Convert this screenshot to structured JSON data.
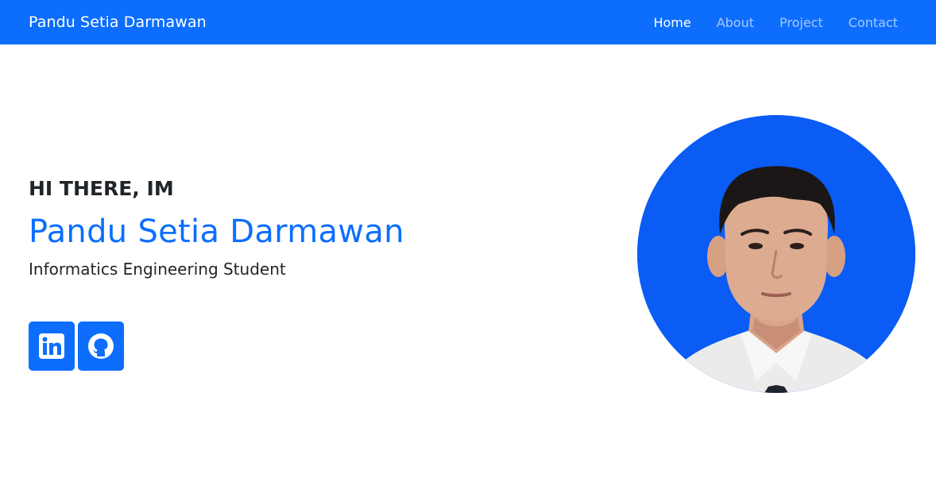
{
  "navbar": {
    "brand": "Pandu Setia Darmawan",
    "links": [
      {
        "label": "Home",
        "active": true
      },
      {
        "label": "About",
        "active": false
      },
      {
        "label": "Project",
        "active": false
      },
      {
        "label": "Contact",
        "active": false
      }
    ],
    "bg_color": "#0d6efd"
  },
  "hero": {
    "greeting": "HI THERE, IM",
    "name": "Pandu Setia Darmawan",
    "role": "Informatics Engineering Student",
    "name_color": "#0d6efd"
  },
  "social": [
    {
      "icon": "linkedin-icon"
    },
    {
      "icon": "github-icon"
    }
  ],
  "photo": {
    "background_color": "#0a5cf5",
    "shape": "circle"
  }
}
